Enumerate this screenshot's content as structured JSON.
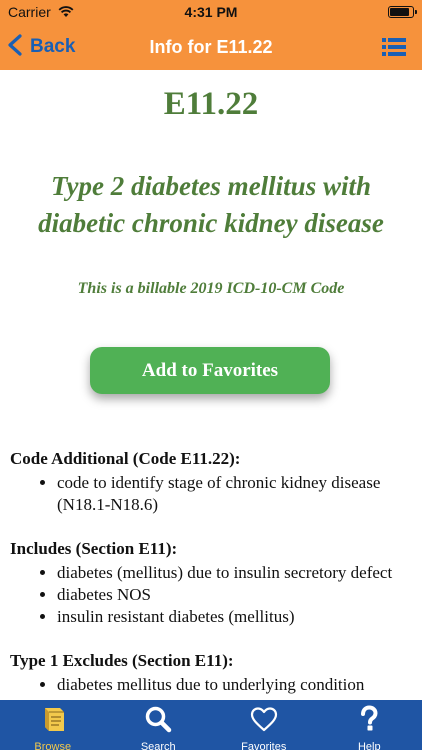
{
  "status_bar": {
    "carrier": "Carrier",
    "time": "4:31 PM",
    "battery_level": 0.9
  },
  "nav": {
    "back_label": "Back",
    "title": "Info for E11.22"
  },
  "code": {
    "id": "E11.22",
    "description": "Type 2 diabetes mellitus with diabetic chronic kidney disease",
    "billable_note": "This is a billable 2019 ICD-10-CM Code"
  },
  "actions": {
    "add_favorite_label": "Add to Favorites"
  },
  "sections": [
    {
      "title": "Code Additional (Code E11.22):",
      "items": [
        "code to identify stage of chronic kidney disease (N18.1-N18.6)"
      ]
    },
    {
      "title": "Includes (Section E11):",
      "items": [
        "diabetes (mellitus) due to insulin secretory defect",
        "diabetes NOS",
        "insulin resistant diabetes (mellitus)"
      ]
    },
    {
      "title": "Type 1 Excludes (Section E11):",
      "items": [
        "diabetes mellitus due to underlying condition"
      ]
    }
  ],
  "tabs": [
    {
      "label": "Browse",
      "icon": "book-icon",
      "active": true
    },
    {
      "label": "Search",
      "icon": "magnifier-icon",
      "active": false
    },
    {
      "label": "Favorites",
      "icon": "heart-icon",
      "active": false
    },
    {
      "label": "Help",
      "icon": "question-icon",
      "active": false
    }
  ],
  "colors": {
    "nav_bg": "#f6923c",
    "accent_blue": "#1a5fb4",
    "title_green": "#4f7d3a",
    "button_green": "#50b155",
    "tab_bg": "#1f55a4",
    "tab_active": "#f2c94c"
  }
}
